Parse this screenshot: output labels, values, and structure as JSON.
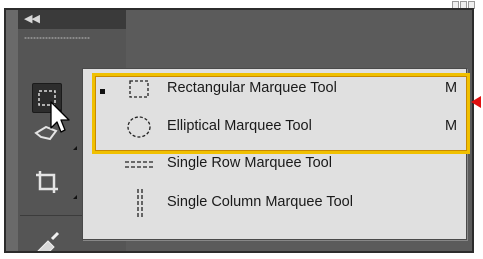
{
  "panel": {
    "collapse_icon": "double-chevron-left",
    "tools": [
      {
        "name": "rectangular-marquee",
        "active": true
      },
      {
        "name": "lasso"
      },
      {
        "name": "crop"
      },
      {
        "name": "eyedropper"
      }
    ]
  },
  "menu": {
    "items": [
      {
        "label": "Rectangular Marquee Tool",
        "shortcut": "M",
        "icon": "dashed-rectangle-icon",
        "selected": true
      },
      {
        "label": "Elliptical Marquee Tool",
        "shortcut": "M",
        "icon": "dashed-ellipse-icon"
      },
      {
        "label": "Single Row Marquee Tool",
        "shortcut": "",
        "icon": "dashed-row-icon"
      },
      {
        "label": "Single Column Marquee Tool",
        "shortcut": "",
        "icon": "dashed-column-icon"
      }
    ]
  },
  "colors": {
    "highlight": "#f0c000",
    "callout": "#e01010",
    "menu_bg": "#e0e0e0",
    "panel_bg": "#555555"
  }
}
